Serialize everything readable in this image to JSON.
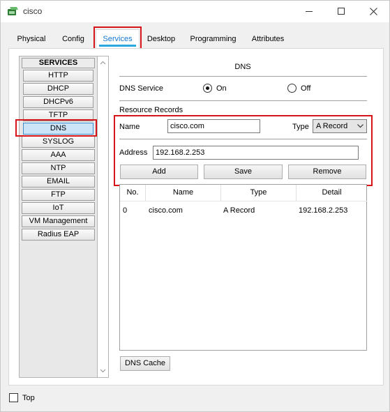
{
  "window": {
    "title": "cisco"
  },
  "tabs": [
    {
      "label": "Physical",
      "active": false
    },
    {
      "label": "Config",
      "active": false
    },
    {
      "label": "Services",
      "active": true
    },
    {
      "label": "Desktop",
      "active": false
    },
    {
      "label": "Programming",
      "active": false
    },
    {
      "label": "Attributes",
      "active": false
    }
  ],
  "services": {
    "header": "SERVICES",
    "items": [
      "HTTP",
      "DHCP",
      "DHCPv6",
      "TFTP",
      "DNS",
      "SYSLOG",
      "AAA",
      "NTP",
      "EMAIL",
      "FTP",
      "IoT",
      "VM Management",
      "Radius EAP"
    ],
    "selected": "DNS"
  },
  "dns": {
    "title": "DNS",
    "service_label": "DNS Service",
    "on_label": "On",
    "off_label": "Off",
    "service_state": "On",
    "records_label": "Resource Records",
    "name_label": "Name",
    "name_value": "cisco.com",
    "type_label": "Type",
    "type_value": "A Record",
    "address_label": "Address",
    "address_value": "192.168.2.253",
    "add_label": "Add",
    "save_label": "Save",
    "remove_label": "Remove",
    "cache_label": "DNS Cache"
  },
  "table": {
    "columns": [
      "No.",
      "Name",
      "Type",
      "Detail"
    ],
    "rows": [
      {
        "no": "0",
        "name": "cisco.com",
        "type": "A Record",
        "detail": "192.168.2.253"
      }
    ]
  },
  "footer": {
    "top_label": "Top",
    "top_checked": false
  },
  "colors": {
    "highlight_red": "#d7141a",
    "active_tab_text": "#1177d4",
    "active_tab_underline": "#2aa8e0",
    "selected_service_bg": "#cce4f7"
  }
}
